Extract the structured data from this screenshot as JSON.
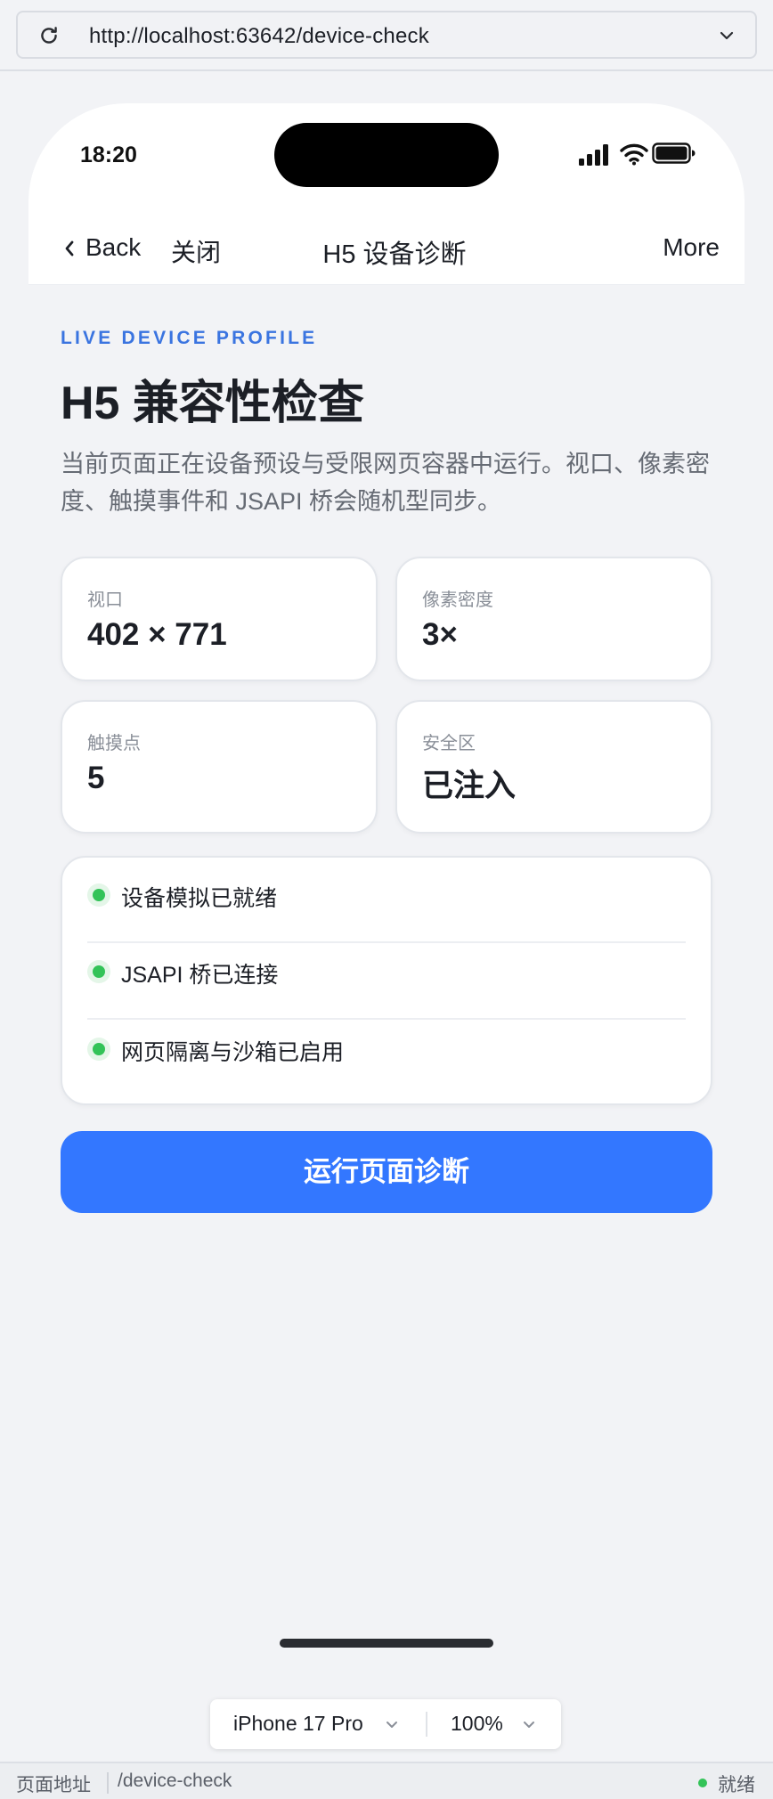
{
  "browser": {
    "url": "http://localhost:63642/device-check"
  },
  "status_bar": {
    "time": "18:20"
  },
  "nav": {
    "back_label": "Back",
    "close_label": "关闭",
    "title": "H5 设备诊断",
    "more_label": "More"
  },
  "main": {
    "eyebrow": "LIVE DEVICE PROFILE",
    "headline": "H5 兼容性检查",
    "description": "当前页面正在设备预设与受限网页容器中运行。视口、像素密度、触摸事件和 JSAPI 桥会随机型同步。",
    "stats": [
      {
        "label": "视口",
        "value": "402 × 771"
      },
      {
        "label": "像素密度",
        "value": "3×"
      },
      {
        "label": "触摸点",
        "value": "5"
      },
      {
        "label": "安全区",
        "value": "已注入"
      }
    ],
    "checks": [
      {
        "label": "设备模拟已就绪"
      },
      {
        "label": "JSAPI 桥已连接"
      },
      {
        "label": "网页隔离与沙箱已启用"
      }
    ],
    "run_button_label": "运行页面诊断"
  },
  "device_toolbar": {
    "device": "iPhone 17 Pro",
    "zoom": "100%"
  },
  "footer": {
    "address_label": "页面地址",
    "path": "/device-check",
    "status": "就绪"
  },
  "colors": {
    "accent": "#3377ff",
    "eyebrow": "#3a74e0",
    "success": "#33c358",
    "background": "#f2f3f6"
  }
}
